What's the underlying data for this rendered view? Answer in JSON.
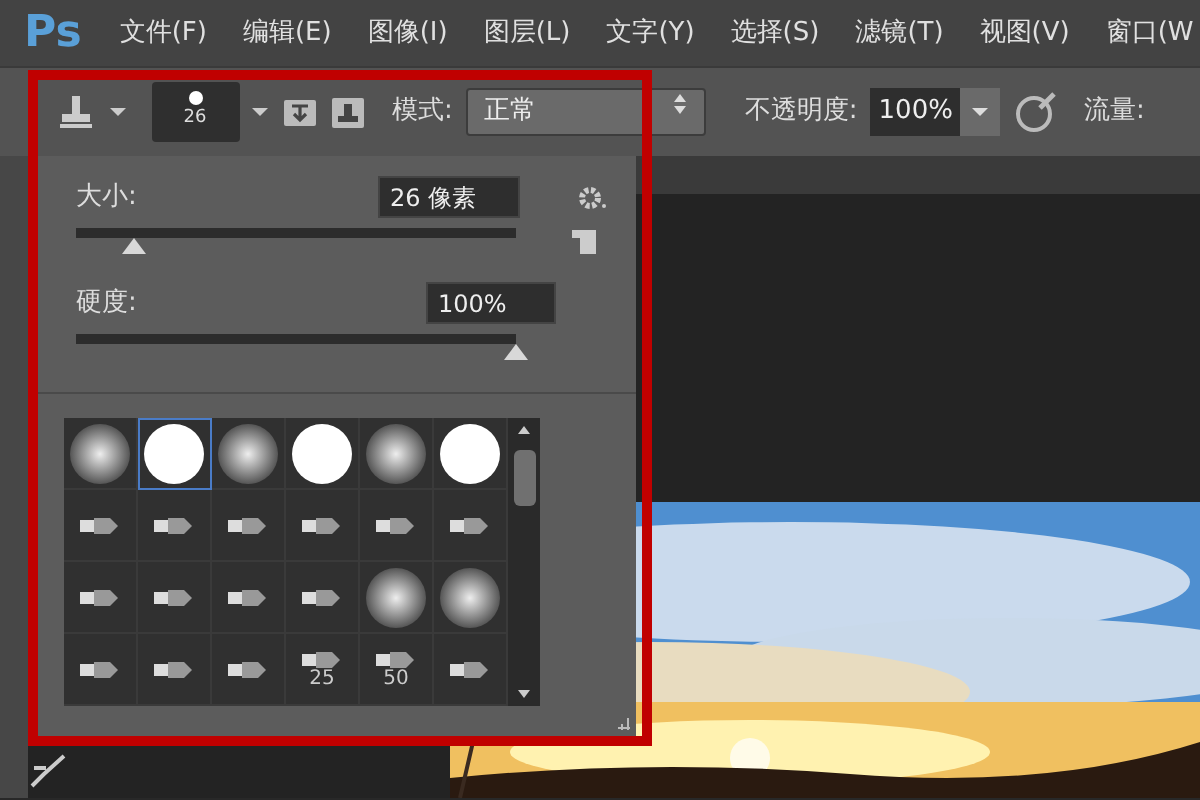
{
  "app_logo": "Ps",
  "menu": [
    "文件(F)",
    "编辑(E)",
    "图像(I)",
    "图层(L)",
    "文字(Y)",
    "选择(S)",
    "滤镜(T)",
    "视图(V)",
    "窗口(W"
  ],
  "options_bar": {
    "brush_size": "26",
    "mode_label": "模式:",
    "mode_value": "正常",
    "opacity_label": "不透明度:",
    "opacity_value": "100%",
    "flow_label": "流量:"
  },
  "brush_panel": {
    "size_label": "大小:",
    "size_value": "26 像素",
    "size_slider": {
      "level": 0.13
    },
    "hardness_label": "硬度:",
    "hardness_value": "100%",
    "hardness_slider": {
      "level": 1.0
    },
    "brushes": [
      {
        "kind": "soft",
        "selected": false
      },
      {
        "kind": "hard",
        "selected": true
      },
      {
        "kind": "soft",
        "selected": false
      },
      {
        "kind": "hard",
        "selected": false
      },
      {
        "kind": "soft",
        "selected": false
      },
      {
        "kind": "hard",
        "selected": false
      },
      {
        "kind": "tip",
        "selected": false
      },
      {
        "kind": "tip",
        "selected": false
      },
      {
        "kind": "tip",
        "selected": false
      },
      {
        "kind": "tip",
        "selected": false
      },
      {
        "kind": "tip",
        "selected": false
      },
      {
        "kind": "tip",
        "selected": false
      },
      {
        "kind": "tip",
        "selected": false
      },
      {
        "kind": "tip",
        "selected": false
      },
      {
        "kind": "tip",
        "selected": false
      },
      {
        "kind": "tip",
        "selected": false
      },
      {
        "kind": "soft",
        "selected": false
      },
      {
        "kind": "soft",
        "selected": false
      },
      {
        "kind": "tip",
        "selected": false
      },
      {
        "kind": "tip",
        "selected": false
      },
      {
        "kind": "tip",
        "selected": false
      },
      {
        "kind": "tip",
        "selected": false,
        "label": "25"
      },
      {
        "kind": "tip",
        "selected": false,
        "label": "50"
      },
      {
        "kind": "tip",
        "selected": false
      }
    ]
  },
  "highlight": {
    "color": "#c00000"
  }
}
